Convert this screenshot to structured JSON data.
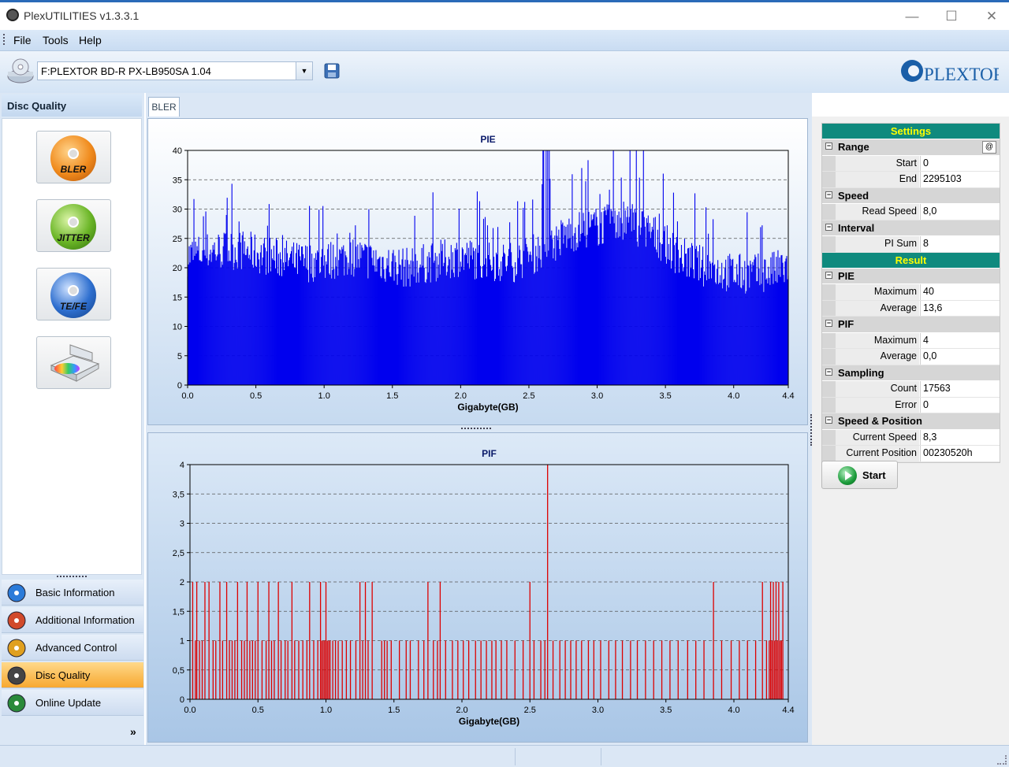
{
  "window": {
    "title": "PlexUTILITIES v1.3.3.1",
    "minimize": "—",
    "maximize": "☐",
    "close": "✕"
  },
  "menu": [
    "File",
    "Tools",
    "Help"
  ],
  "toolbar": {
    "drive": "F:PLEXTOR BD-R  PX-LB950SA 1.04",
    "logo": "PLEXTOR"
  },
  "left": {
    "header": "Disc Quality",
    "tiles": [
      {
        "label": "BLER",
        "color": "#f08a1c"
      },
      {
        "label": "JITTER",
        "color": "#6ab526"
      },
      {
        "label": "TE/FE",
        "color": "#2e6fcf"
      },
      {
        "label": "",
        "color": "#cccccc"
      }
    ],
    "nav": [
      {
        "label": "Basic Information",
        "active": false
      },
      {
        "label": "Additional Information",
        "active": false
      },
      {
        "label": "Advanced Control",
        "active": false
      },
      {
        "label": "Disc Quality",
        "active": true
      },
      {
        "label": "Online Update",
        "active": false
      }
    ]
  },
  "tab": "BLER",
  "grid": {
    "settings_title": "Settings",
    "range_label": "Range",
    "at_symbol": "@",
    "start_key": "Start",
    "start_val": "0",
    "end_key": "End",
    "end_val": "2295103",
    "speed_label": "Speed",
    "readspeed_key": "Read Speed",
    "readspeed_val": "8,0",
    "interval_label": "Interval",
    "pisum_key": "PI Sum",
    "pisum_val": "8",
    "result_title": "Result",
    "pie_label": "PIE",
    "pie_max_key": "Maximum",
    "pie_max_val": "40",
    "pie_avg_key": "Average",
    "pie_avg_val": "13,6",
    "pif_label": "PIF",
    "pif_max_key": "Maximum",
    "pif_max_val": "4",
    "pif_avg_key": "Average",
    "pif_avg_val": "0,0",
    "sampling_label": "Sampling",
    "count_key": "Count",
    "count_val": "17563",
    "error_key": "Error",
    "error_val": "0",
    "sp_label": "Speed & Position",
    "curspeed_key": "Current Speed",
    "curspeed_val": "8,3",
    "curpos_key": "Current Position",
    "curpos_val": "00230520h"
  },
  "start_button": "Start",
  "chart_data": [
    {
      "type": "bar",
      "title": "PIE",
      "xlabel": "Gigabyte(GB)",
      "ylabel": "",
      "xlim": [
        0,
        4.4
      ],
      "ylim": [
        0,
        40
      ],
      "xticks": [
        "0.0",
        "0.5",
        "1.0",
        "1.5",
        "2.0",
        "2.5",
        "3.0",
        "3.5",
        "4.0",
        "4.4"
      ],
      "yticks": [
        "0",
        "5",
        "10",
        "15",
        "20",
        "25",
        "30",
        "35",
        "40"
      ],
      "color": "#0000ee",
      "envelope_x": [
        0.0,
        0.2,
        0.4,
        0.6,
        0.8,
        1.0,
        1.2,
        1.4,
        1.6,
        1.8,
        2.0,
        2.2,
        2.4,
        2.6,
        2.8,
        3.0,
        3.2,
        3.4,
        3.6,
        3.8,
        4.0,
        4.2,
        4.4
      ],
      "envelope_y": [
        22,
        23,
        23,
        22,
        21,
        21,
        22,
        21,
        20,
        21,
        22,
        21,
        21,
        23,
        26,
        27,
        28,
        26,
        22,
        20,
        19,
        19,
        20
      ],
      "maximum": 40,
      "average": 13.6
    },
    {
      "type": "bar",
      "title": "PIF",
      "xlabel": "Gigabyte(GB)",
      "ylabel": "",
      "xlim": [
        0,
        4.4
      ],
      "ylim": [
        0,
        4
      ],
      "xticks": [
        "0.0",
        "0.5",
        "1.0",
        "1.5",
        "2.0",
        "2.5",
        "3.0",
        "3.5",
        "4.0",
        "4.4"
      ],
      "yticks": [
        "0",
        "0,5",
        "1",
        "1,5",
        "2",
        "2,5",
        "3",
        "3,5",
        "4"
      ],
      "color": "#dd0000",
      "spikes_x": [
        0.02,
        0.04,
        0.05,
        0.07,
        0.09,
        0.11,
        0.14,
        0.17,
        0.19,
        0.22,
        0.24,
        0.27,
        0.29,
        0.31,
        0.33,
        0.35,
        0.38,
        0.4,
        0.42,
        0.44,
        0.46,
        0.48,
        0.5,
        0.53,
        0.56,
        0.58,
        0.6,
        0.62,
        0.65,
        0.67,
        0.7,
        0.72,
        0.75,
        0.77,
        0.8,
        0.83,
        0.86,
        0.88,
        0.91,
        0.94,
        0.96,
        0.97,
        0.98,
        0.99,
        1.0,
        1.01,
        1.02,
        1.03,
        1.05,
        1.07,
        1.09,
        1.12,
        1.15,
        1.18,
        1.22,
        1.25,
        1.27,
        1.29,
        1.31,
        1.34,
        1.41,
        1.43,
        1.45,
        1.48,
        1.54,
        1.59,
        1.62,
        1.68,
        1.72,
        1.75,
        1.79,
        1.82,
        1.84,
        1.88,
        1.93,
        1.97,
        2.01,
        2.05,
        2.1,
        2.14,
        2.18,
        2.22,
        2.25,
        2.29,
        2.33,
        2.39,
        2.45,
        2.5,
        2.53,
        2.58,
        2.61,
        2.63,
        2.67,
        2.72,
        2.76,
        2.8,
        2.84,
        2.88,
        2.93,
        2.97,
        3.02,
        3.08,
        3.13,
        3.18,
        3.24,
        3.29,
        3.35,
        3.41,
        3.47,
        3.53,
        3.59,
        3.66,
        3.72,
        3.78,
        3.85,
        3.91,
        3.98,
        4.04,
        4.1,
        4.16,
        4.21,
        4.24,
        4.26,
        4.27,
        4.28,
        4.29,
        4.3,
        4.31,
        4.32,
        4.33,
        4.34,
        4.35,
        4.36
      ],
      "spikes_y": [
        2,
        1,
        2,
        1,
        1,
        2,
        2,
        1,
        1,
        2,
        1,
        2,
        1,
        1,
        1,
        2,
        1,
        1,
        2,
        1,
        1,
        1,
        2,
        1,
        1,
        2,
        1,
        1,
        2,
        1,
        1,
        1,
        2,
        1,
        1,
        1,
        1,
        2,
        1,
        1,
        2,
        1,
        1,
        1,
        2,
        1,
        1,
        1,
        1,
        1,
        1,
        1,
        1,
        1,
        1,
        2,
        1,
        2,
        1,
        2,
        1,
        1,
        1,
        1,
        1,
        1,
        1,
        1,
        1,
        2,
        1,
        1,
        2,
        1,
        1,
        1,
        1,
        1,
        1,
        1,
        1,
        1,
        1,
        1,
        1,
        1,
        1,
        2,
        1,
        1,
        1,
        4,
        1,
        1,
        1,
        1,
        1,
        1,
        1,
        1,
        1,
        1,
        1,
        1,
        1,
        1,
        1,
        1,
        1,
        1,
        1,
        1,
        1,
        1,
        2,
        1,
        1,
        1,
        1,
        1,
        2,
        1,
        1,
        2,
        1,
        2,
        1,
        2,
        1,
        2,
        1,
        1,
        2
      ],
      "maximum": 4,
      "average": 0.0
    }
  ]
}
